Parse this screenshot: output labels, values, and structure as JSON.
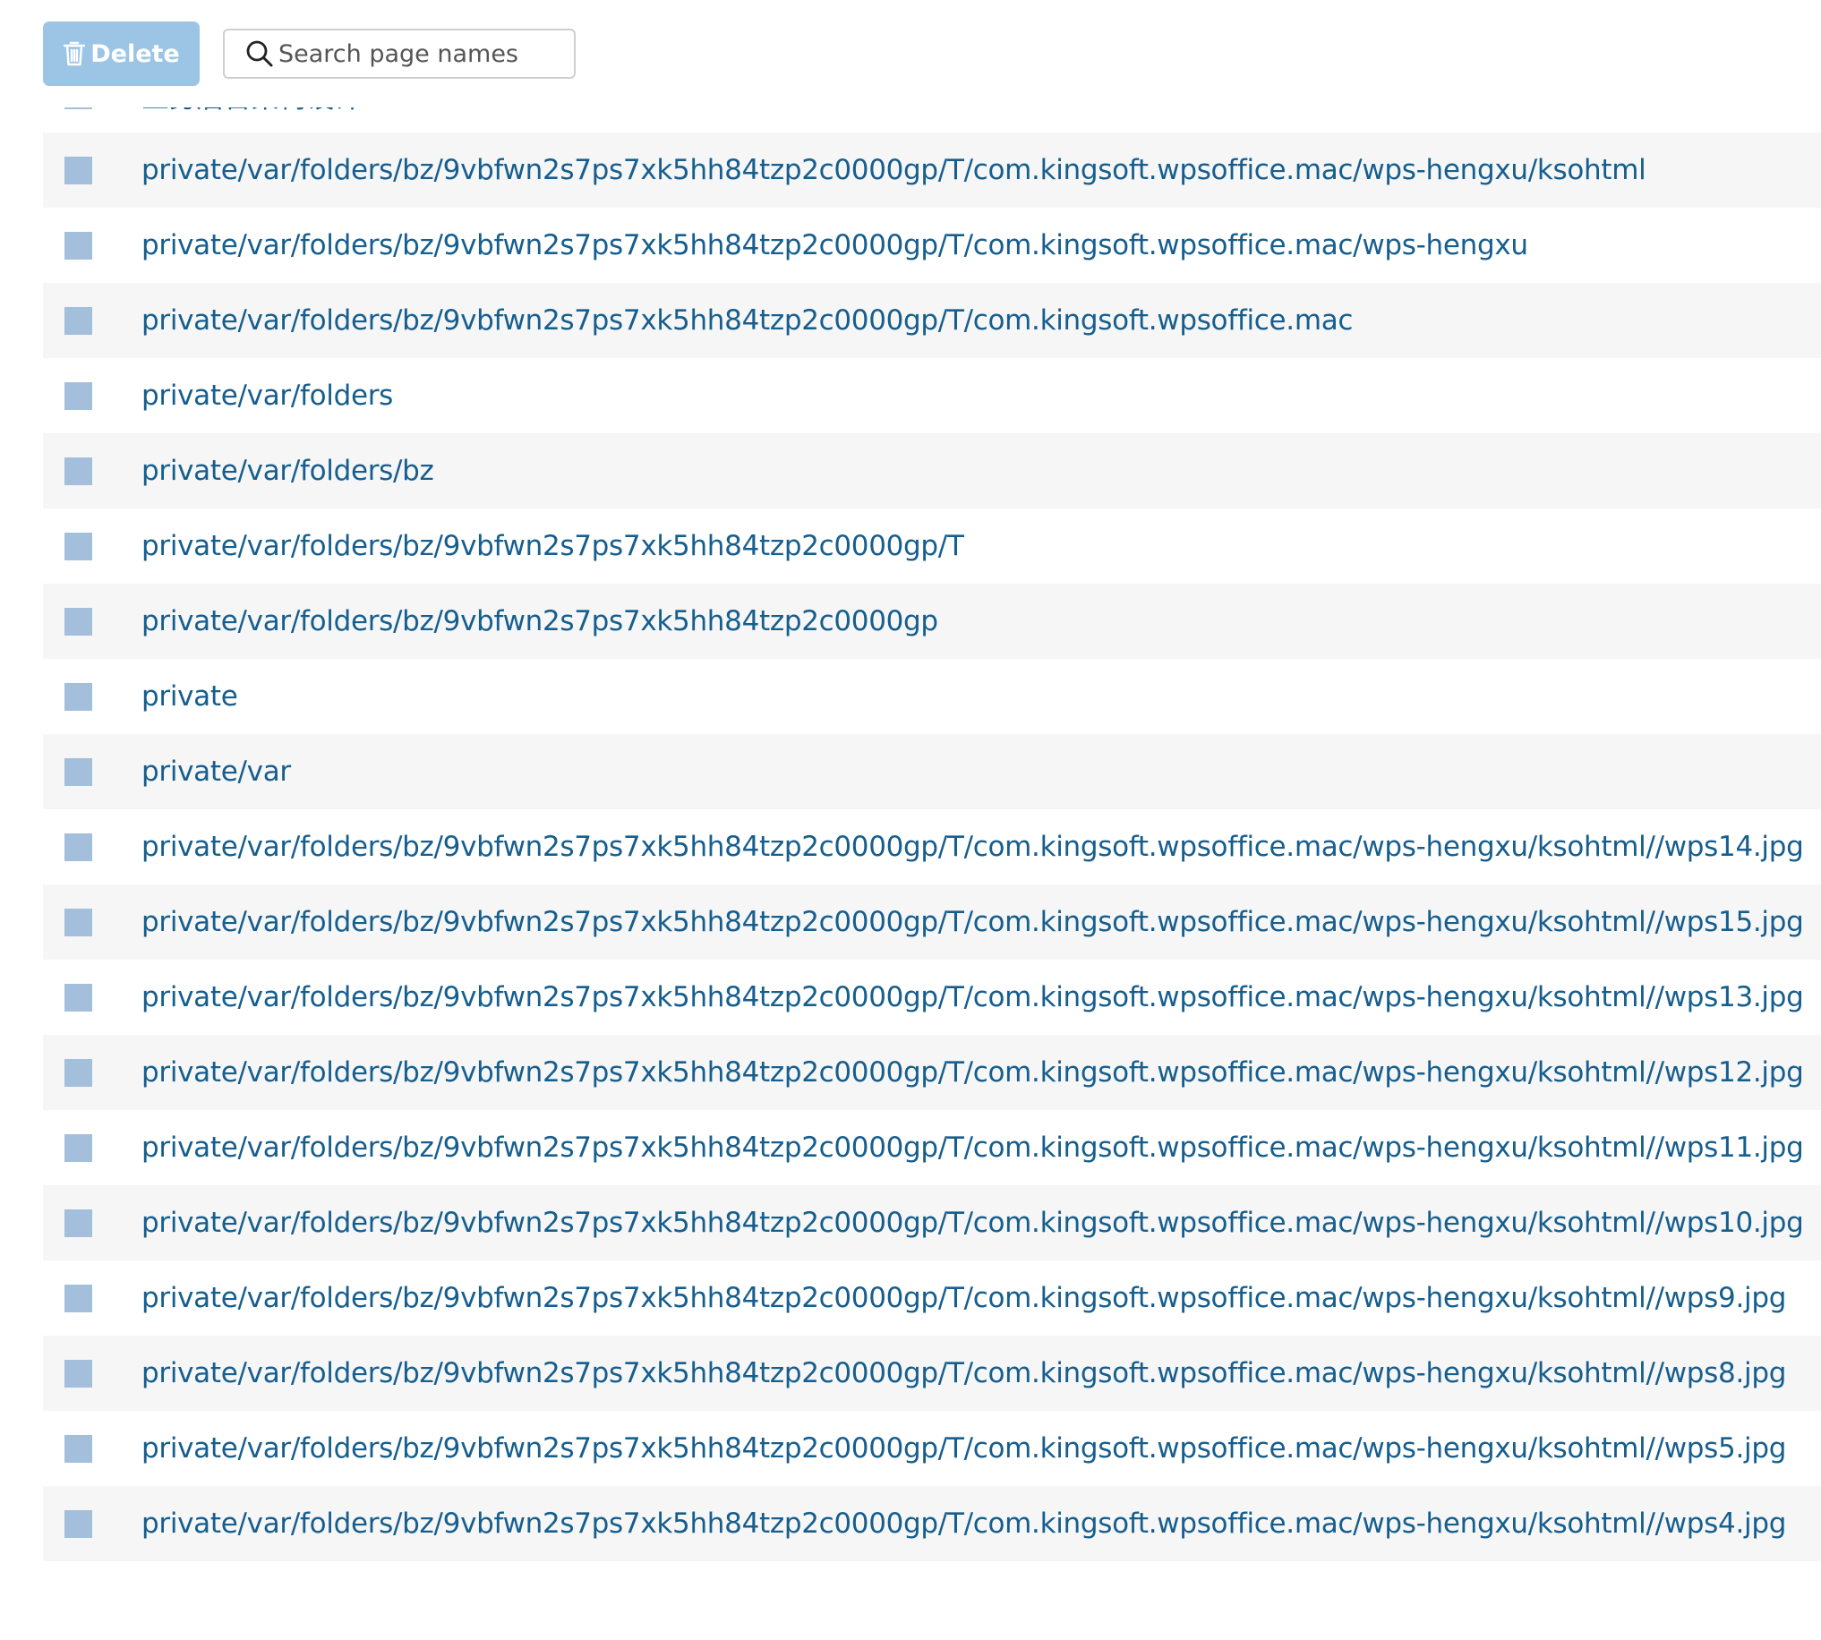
{
  "toolbar": {
    "delete_label": "Delete",
    "search_placeholder": "Search page names",
    "search_value": ""
  },
  "colors": {
    "delete_button_bg": "#9cc5e5",
    "link_text": "#165e8e",
    "checkbox": "#a3bfdc",
    "row_alt_bg": "#f6f6f6"
  },
  "pages": [
    {
      "name": "业务后台架构设计"
    },
    {
      "name": "private/var/folders/bz/9vbfwn2s7ps7xk5hh84tzp2c0000gp/T/com.kingsoft.wpsoffice.mac/wps-hengxu/ksohtml"
    },
    {
      "name": "private/var/folders/bz/9vbfwn2s7ps7xk5hh84tzp2c0000gp/T/com.kingsoft.wpsoffice.mac/wps-hengxu"
    },
    {
      "name": "private/var/folders/bz/9vbfwn2s7ps7xk5hh84tzp2c0000gp/T/com.kingsoft.wpsoffice.mac"
    },
    {
      "name": "private/var/folders"
    },
    {
      "name": "private/var/folders/bz"
    },
    {
      "name": "private/var/folders/bz/9vbfwn2s7ps7xk5hh84tzp2c0000gp/T"
    },
    {
      "name": "private/var/folders/bz/9vbfwn2s7ps7xk5hh84tzp2c0000gp"
    },
    {
      "name": "private"
    },
    {
      "name": "private/var"
    },
    {
      "name": "private/var/folders/bz/9vbfwn2s7ps7xk5hh84tzp2c0000gp/T/com.kingsoft.wpsoffice.mac/wps-hengxu/ksohtml//wps14.jpg"
    },
    {
      "name": "private/var/folders/bz/9vbfwn2s7ps7xk5hh84tzp2c0000gp/T/com.kingsoft.wpsoffice.mac/wps-hengxu/ksohtml//wps15.jpg"
    },
    {
      "name": "private/var/folders/bz/9vbfwn2s7ps7xk5hh84tzp2c0000gp/T/com.kingsoft.wpsoffice.mac/wps-hengxu/ksohtml//wps13.jpg"
    },
    {
      "name": "private/var/folders/bz/9vbfwn2s7ps7xk5hh84tzp2c0000gp/T/com.kingsoft.wpsoffice.mac/wps-hengxu/ksohtml//wps12.jpg"
    },
    {
      "name": "private/var/folders/bz/9vbfwn2s7ps7xk5hh84tzp2c0000gp/T/com.kingsoft.wpsoffice.mac/wps-hengxu/ksohtml//wps11.jpg"
    },
    {
      "name": "private/var/folders/bz/9vbfwn2s7ps7xk5hh84tzp2c0000gp/T/com.kingsoft.wpsoffice.mac/wps-hengxu/ksohtml//wps10.jpg"
    },
    {
      "name": "private/var/folders/bz/9vbfwn2s7ps7xk5hh84tzp2c0000gp/T/com.kingsoft.wpsoffice.mac/wps-hengxu/ksohtml//wps9.jpg"
    },
    {
      "name": "private/var/folders/bz/9vbfwn2s7ps7xk5hh84tzp2c0000gp/T/com.kingsoft.wpsoffice.mac/wps-hengxu/ksohtml//wps8.jpg"
    },
    {
      "name": "private/var/folders/bz/9vbfwn2s7ps7xk5hh84tzp2c0000gp/T/com.kingsoft.wpsoffice.mac/wps-hengxu/ksohtml//wps5.jpg"
    },
    {
      "name": "private/var/folders/bz/9vbfwn2s7ps7xk5hh84tzp2c0000gp/T/com.kingsoft.wpsoffice.mac/wps-hengxu/ksohtml//wps4.jpg"
    }
  ]
}
